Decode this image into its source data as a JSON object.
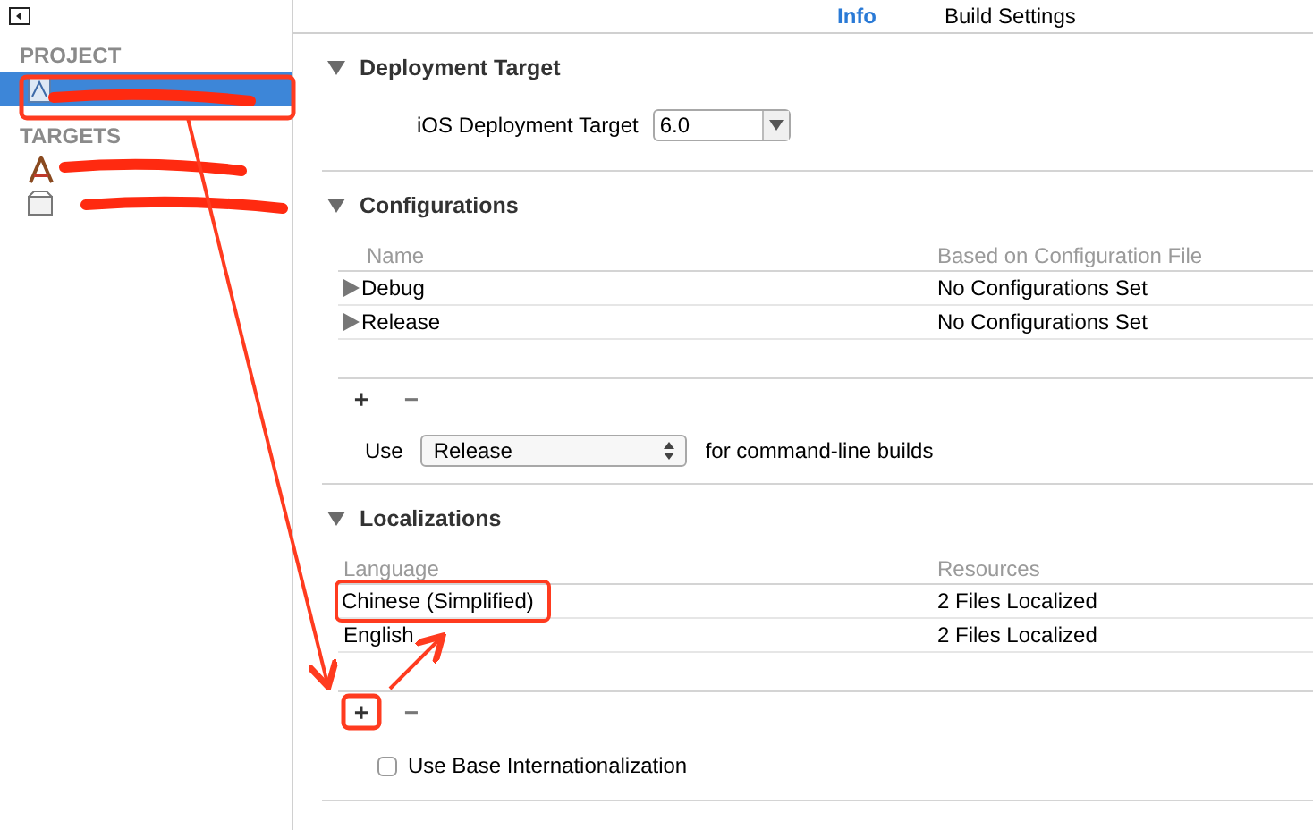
{
  "tabs": [
    {
      "label": "Info",
      "selected": true
    },
    {
      "label": "Build Settings",
      "selected": false
    }
  ],
  "sidebar": {
    "sections": [
      {
        "title": "PROJECT",
        "items": [
          {
            "kind": "project",
            "selected": true
          }
        ]
      },
      {
        "title": "TARGETS",
        "items": [
          {
            "kind": "app",
            "selected": false
          },
          {
            "kind": "tests",
            "selected": false
          }
        ]
      }
    ]
  },
  "deployment_target": {
    "title": "Deployment Target",
    "expanded": true,
    "label": "iOS Deployment Target",
    "value": "6.0"
  },
  "configurations": {
    "title": "Configurations",
    "expanded": true,
    "columns": [
      "Name",
      "Based on Configuration File"
    ],
    "rows": [
      {
        "name": "Debug",
        "file": "No Configurations Set"
      },
      {
        "name": "Release",
        "file": "No Configurations Set"
      }
    ],
    "add": "+",
    "remove": "−",
    "use_label": "Use",
    "use_value": "Release",
    "use_suffix": "for command-line builds"
  },
  "localizations": {
    "title": "Localizations",
    "expanded": true,
    "columns": [
      "Language",
      "Resources"
    ],
    "rows": [
      {
        "language": "Chinese (Simplified)",
        "resources": "2 Files Localized"
      },
      {
        "language": "English",
        "resources": "2 Files Localized"
      }
    ],
    "add": "+",
    "remove": "−",
    "base_label": "Use Base Internationalization",
    "base_checked": false
  }
}
